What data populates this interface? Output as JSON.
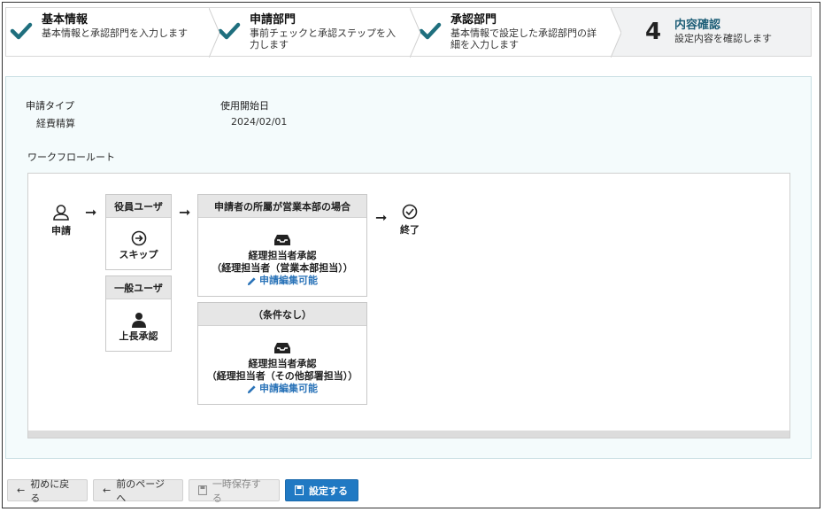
{
  "stepper": {
    "steps": [
      {
        "title": "基本情報",
        "desc": "基本情報と承認部門を入力します",
        "state": "done"
      },
      {
        "title": "申請部門",
        "desc": "事前チェックと承認ステップを入力します",
        "state": "done"
      },
      {
        "title": "承認部門",
        "desc": "基本情報で設定した承認部門の詳細を入力します",
        "state": "done"
      },
      {
        "number": "4",
        "title": "内容確認",
        "desc": "設定内容を確認します",
        "state": "active"
      }
    ]
  },
  "summary": {
    "type_label": "申請タイプ",
    "type_value": "経費精算",
    "start_label": "使用開始日",
    "start_value": "2024/02/01",
    "route_label": "ワークフロールート"
  },
  "flow": {
    "start_label": "申請",
    "end_label": "終了",
    "role_boxes": [
      {
        "header": "役員ユーザ",
        "label": "スキップ",
        "icon": "arrow-circle-icon"
      },
      {
        "header": "一般ユーザ",
        "label": "上長承認",
        "icon": "user-icon"
      }
    ],
    "condition_boxes": [
      {
        "header": "申請者の所屬が営業本部の場合",
        "line1": "経理担当者承認",
        "line2": "（経理担当者（営業本部担当））",
        "edit": "申請編集可能",
        "icon": "inbox-icon"
      },
      {
        "header": "（条件なし）",
        "line1": "経理担当者承認",
        "line2": "（経理担当者（その他部署担当））",
        "edit": "申請編集可能",
        "icon": "inbox-icon"
      }
    ]
  },
  "footer": {
    "back_first": "初めに戻る",
    "prev_page": "前のページへ",
    "save_temp": "一時保存する",
    "submit": "設定する"
  },
  "colors": {
    "check": "#1f6f7e",
    "primary": "#2079c3",
    "edit_link": "#2a73b8"
  }
}
